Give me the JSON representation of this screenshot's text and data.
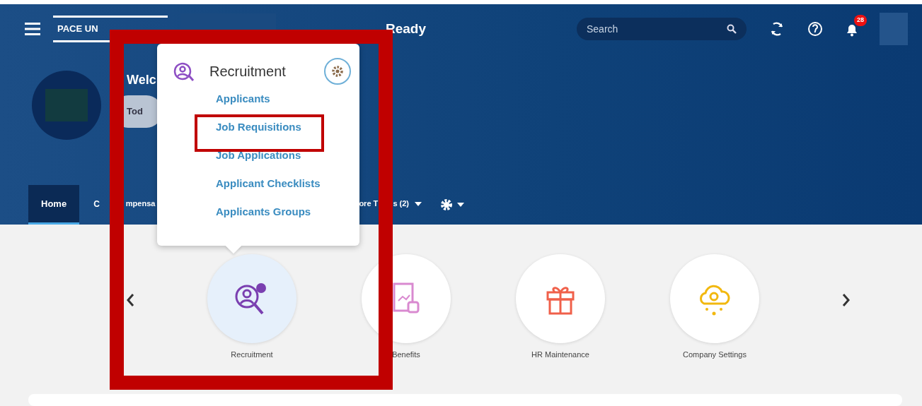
{
  "header": {
    "logo": "PACE UN",
    "title": "Ready",
    "search": {
      "placeholder": "Search"
    },
    "notification_count": "28"
  },
  "welcome": {
    "greeting": "Welc",
    "button": "Tod"
  },
  "tabs": [
    {
      "label": "Home",
      "selected": true
    },
    {
      "label": "C",
      "label_continued": "mpensa",
      "selected": false
    },
    {
      "label": "ore T",
      "label_continued": "s (2)",
      "selected": false
    }
  ],
  "popup": {
    "title": "Recruitment",
    "links": [
      {
        "label": "Applicants",
        "highlighted": false
      },
      {
        "label": "Job Requisitions",
        "highlighted": true
      },
      {
        "label": "Job Applications",
        "highlighted": false
      },
      {
        "label": "Applicant Checklists",
        "highlighted": false
      },
      {
        "label": "Applicants Groups",
        "highlighted": false
      }
    ]
  },
  "modules": [
    {
      "label": "Recruitment",
      "selected": true
    },
    {
      "label": "Benefits",
      "selected": false
    },
    {
      "label": "HR Maintenance",
      "selected": false
    },
    {
      "label": "Company Settings",
      "selected": false
    }
  ],
  "outer_frame": true
}
